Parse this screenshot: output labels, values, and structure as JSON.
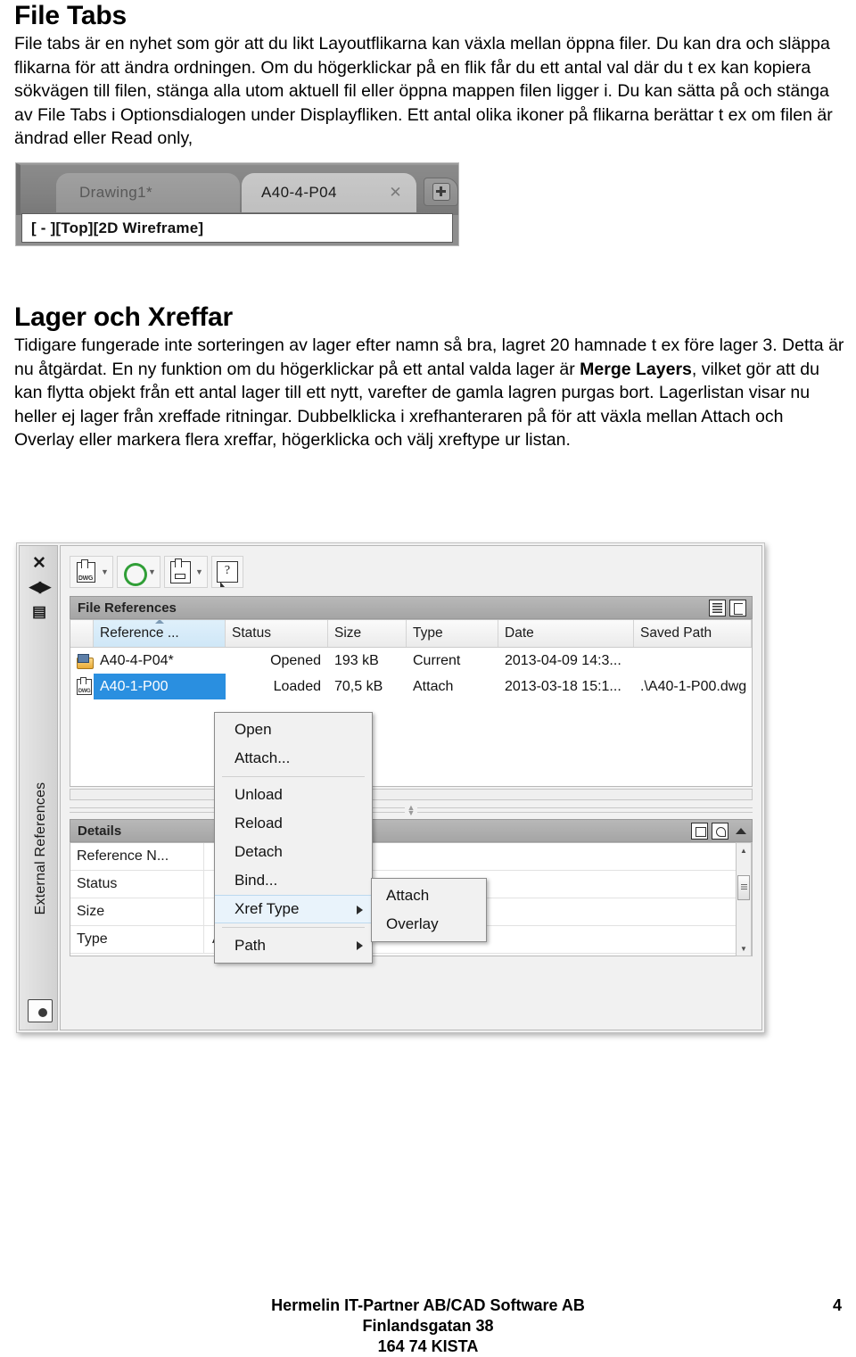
{
  "doc": {
    "sections": [
      {
        "title": "File Tabs",
        "paragraph": "File tabs är en nyhet som gör att du likt Layoutflikarna kan växla mellan öppna filer. Du kan dra och släppa flikarna för att ändra ordningen. Om du högerklickar på en flik får du ett antal val där du t ex kan kopiera sökvägen till filen, stänga alla utom aktuell fil eller öppna mappen filen ligger i. Du kan sätta på och stänga av File Tabs i Optionsdialogen under Displayfliken. Ett antal olika ikoner på flikarna berättar t ex om filen är ändrad eller Read only,"
      },
      {
        "title": "Lager och Xreffar",
        "paragraph_part1": "Tidigare fungerade inte sorteringen av lager efter namn så bra, lagret 20 hamnade t ex före lager 3. Detta är nu åtgärdat. En ny funktion om du högerklickar på ett antal valda lager är ",
        "paragraph_bold": "Merge Layers",
        "paragraph_part2": ", vilket gör att du kan flytta objekt från ett antal lager till ett nytt, varefter de gamla lagren purgas bort. Lagerlistan visar nu heller ej lager från xreffade ritningar. Dubbelklicka i xrefhanteraren på för att växla mellan Attach och Overlay eller markera flera xreffar, högerklicka och välj xreftype ur listan."
      }
    ]
  },
  "filetabs_image": {
    "tabs": [
      {
        "label": "Drawing1*",
        "state": "inactive"
      },
      {
        "label": "A40-4-P04",
        "state": "active",
        "close": "✕"
      }
    ],
    "new_tab_icon": "plus-icon",
    "canvas_label": "[ - ][Top][2D Wireframe]"
  },
  "xref_palette": {
    "vertical_title": "External References",
    "rail": {
      "close_icon": "✕",
      "autohide_icon": "◀▶",
      "properties_icon": "▤",
      "bottom_icon": "xref-palette-icon"
    },
    "toolbar": [
      {
        "name": "attach-dwg-button",
        "icon": "dwg-icon",
        "label": "DWG",
        "has_dropdown": true
      },
      {
        "name": "refresh-button",
        "icon": "refresh-icon",
        "has_dropdown": true
      },
      {
        "name": "attach-image-button",
        "icon": "pdf-underlay-icon",
        "has_dropdown": true
      },
      {
        "name": "help-button",
        "icon": "question-icon",
        "label": "?",
        "has_dropdown": false
      }
    ],
    "file_references": {
      "header": "File References",
      "view_icons": [
        "list-view-icon",
        "tree-view-icon"
      ],
      "columns": [
        "",
        "Reference ...",
        "Status",
        "Size",
        "Type",
        "Date",
        "Saved Path"
      ],
      "sorted_column": "Reference ...",
      "rows": [
        {
          "icon": "folder-current-icon",
          "reference": "A40-4-P04*",
          "status": "Opened",
          "size": "193 kB",
          "type": "Current",
          "date": "2013-04-09 14:3...",
          "saved_path": "",
          "selected": false
        },
        {
          "icon": "dwg-file-icon",
          "reference": "A40-1-P00",
          "status": "Loaded",
          "size": "70,5 kB",
          "type": "Attach",
          "date": "2013-03-18 15:1...",
          "saved_path": ".\\A40-1-P00.dwg",
          "selected": true
        }
      ]
    },
    "details": {
      "header": "Details",
      "icons": [
        "collapse-icon",
        "zoom-to-xref-icon",
        "caret-up-icon"
      ],
      "rows": [
        {
          "key": "Reference N...",
          "value": ""
        },
        {
          "key": "Status",
          "value": ""
        },
        {
          "key": "Size",
          "value": ""
        },
        {
          "key": "Type",
          "value": "Attach"
        }
      ]
    },
    "context_menu": {
      "items": [
        {
          "label": "Open",
          "submenu": false,
          "highlighted": false
        },
        {
          "label": "Attach...",
          "submenu": false,
          "highlighted": false
        },
        {
          "separator": true
        },
        {
          "label": "Unload",
          "submenu": false,
          "highlighted": false
        },
        {
          "label": "Reload",
          "submenu": false,
          "highlighted": false
        },
        {
          "label": "Detach",
          "submenu": false,
          "highlighted": false
        },
        {
          "label": "Bind...",
          "submenu": false,
          "highlighted": false
        },
        {
          "label": "Xref Type",
          "submenu": true,
          "highlighted": true
        },
        {
          "separator": true
        },
        {
          "label": "Path",
          "submenu": true,
          "highlighted": false
        }
      ],
      "submenu": {
        "items": [
          {
            "label": "Attach"
          },
          {
            "label": "Overlay"
          }
        ]
      }
    }
  },
  "footer": {
    "line1": "Hermelin IT-Partner AB/CAD Software AB",
    "line2": "Finlandsgatan 38",
    "line3": "164 74 KISTA",
    "page_number": "4"
  }
}
